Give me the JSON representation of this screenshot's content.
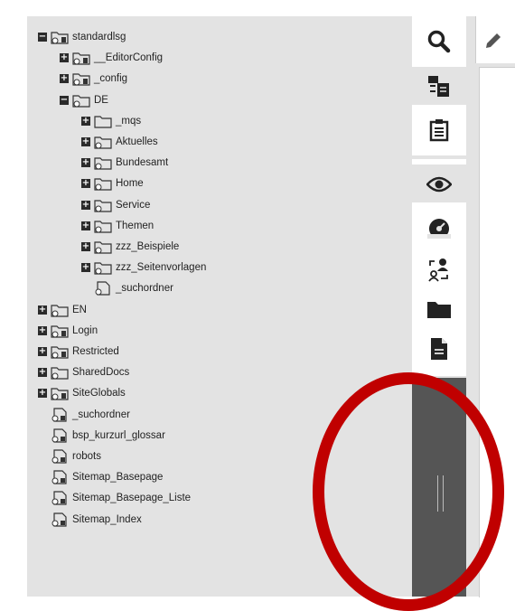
{
  "tree": {
    "nodes": [
      {
        "label": "standardlsg",
        "toggle": "minus",
        "icon": "globe-folder",
        "depth": 0
      },
      {
        "label": "__EditorConfig",
        "toggle": "plus",
        "icon": "globe-folder",
        "depth": 1
      },
      {
        "label": "_config",
        "toggle": "plus",
        "icon": "globe-folder",
        "depth": 1
      },
      {
        "label": "DE",
        "toggle": "minus",
        "icon": "folder-outline",
        "depth": 1
      },
      {
        "label": "_mqs",
        "toggle": "plus",
        "icon": "folder-plain",
        "depth": 2
      },
      {
        "label": "Aktuelles",
        "toggle": "plus",
        "icon": "folder-outline",
        "depth": 2
      },
      {
        "label": "Bundesamt",
        "toggle": "plus",
        "icon": "folder-outline",
        "depth": 2
      },
      {
        "label": "Home",
        "toggle": "plus",
        "icon": "folder-outline",
        "depth": 2
      },
      {
        "label": "Service",
        "toggle": "plus",
        "icon": "folder-outline",
        "depth": 2
      },
      {
        "label": "Themen",
        "toggle": "plus",
        "icon": "folder-outline",
        "depth": 2
      },
      {
        "label": "zzz_Beispiele",
        "toggle": "plus",
        "icon": "folder-outline",
        "depth": 2
      },
      {
        "label": "zzz_Seitenvorlagen",
        "toggle": "plus",
        "icon": "folder-outline",
        "depth": 2
      },
      {
        "label": "_suchordner",
        "toggle": "none",
        "icon": "page-doc",
        "depth": 2
      },
      {
        "label": "EN",
        "toggle": "plus",
        "icon": "folder-outline",
        "depth": 0
      },
      {
        "label": "Login",
        "toggle": "plus",
        "icon": "globe-folder",
        "depth": 0
      },
      {
        "label": "Restricted",
        "toggle": "plus",
        "icon": "globe-folder",
        "depth": 0
      },
      {
        "label": "SharedDocs",
        "toggle": "plus",
        "icon": "folder-outline",
        "depth": 0
      },
      {
        "label": "SiteGlobals",
        "toggle": "plus",
        "icon": "globe-folder",
        "depth": 0
      },
      {
        "label": "_suchordner",
        "toggle": "none",
        "icon": "globe-doc",
        "depth": 0
      },
      {
        "label": "bsp_kurzurl_glossar",
        "toggle": "none",
        "icon": "globe-doc",
        "depth": 0
      },
      {
        "label": "robots",
        "toggle": "none",
        "icon": "globe-doc",
        "depth": 0
      },
      {
        "label": "Sitemap_Basepage",
        "toggle": "none",
        "icon": "globe-doc",
        "depth": 0
      },
      {
        "label": "Sitemap_Basepage_Liste",
        "toggle": "none",
        "icon": "globe-doc",
        "depth": 0
      },
      {
        "label": "Sitemap_Index",
        "toggle": "none",
        "icon": "globe-doc",
        "depth": 0
      }
    ]
  },
  "toolbar": {
    "top_icons": [
      "search-icon",
      "site-tree-icon",
      "clipboard-icon"
    ],
    "bottom_icons": [
      "eye-icon",
      "dashboard-icon",
      "user-assign-icon",
      "folder-icon",
      "document-icon"
    ],
    "edit_icon": "pencil-icon"
  },
  "colors": {
    "panel": "#e3e3e3",
    "splitter": "#555555",
    "annotation": "#c00000",
    "icon": "#222222"
  }
}
